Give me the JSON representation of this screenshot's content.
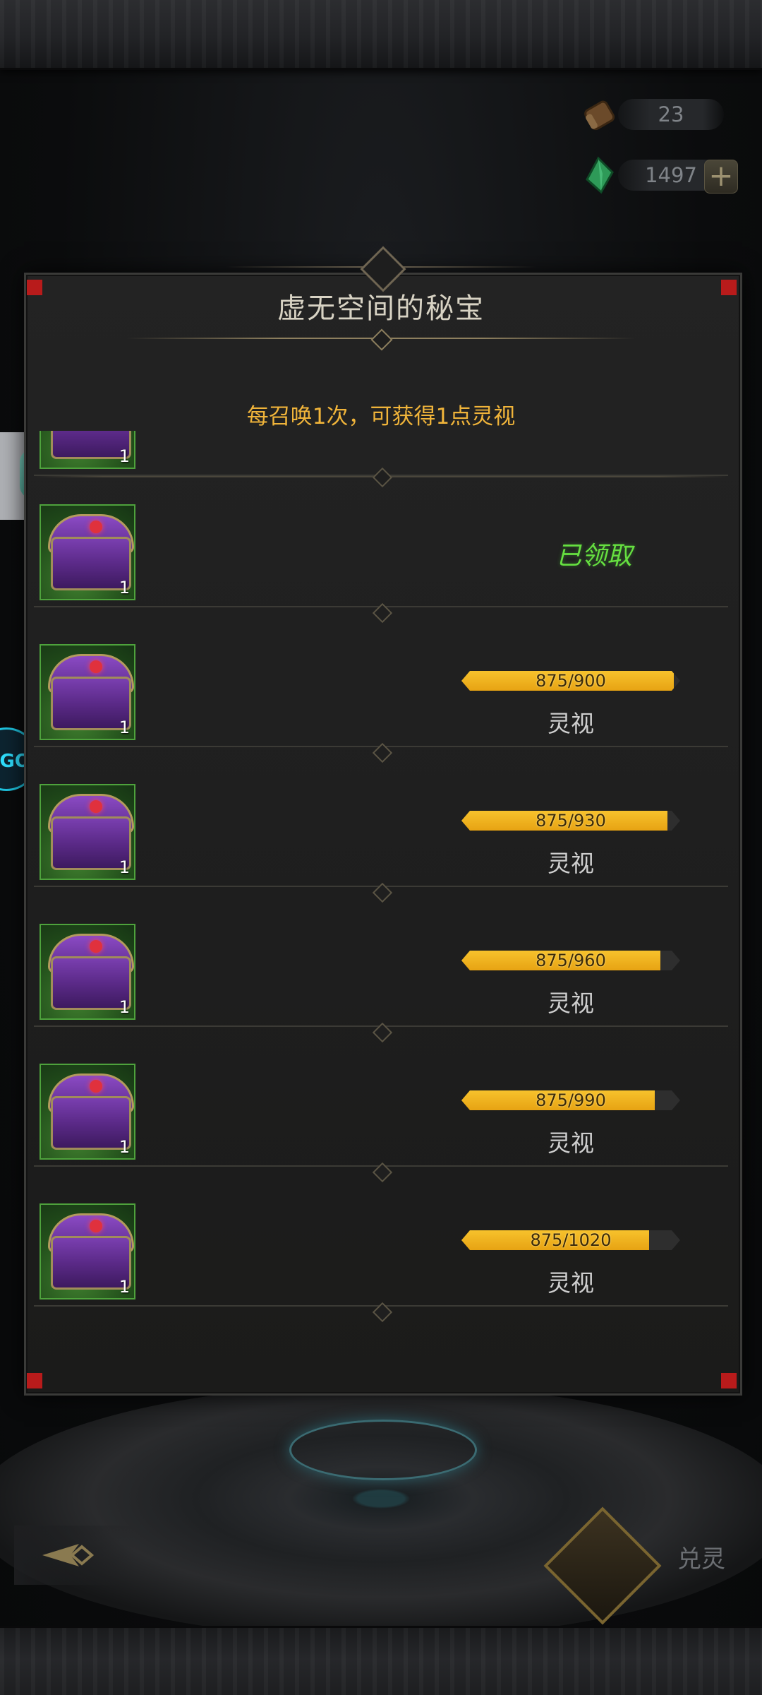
{
  "currencies": {
    "scroll": {
      "icon": "scroll-icon",
      "value": "23"
    },
    "gem": {
      "icon": "green-gem-icon",
      "value": "1497",
      "add_label": "+"
    }
  },
  "panel": {
    "title": "虚无空间的秘宝",
    "subtitle": "每召唤1次，可获得1点灵视"
  },
  "rewards": [
    {
      "count": "1",
      "status": "partial-visible"
    },
    {
      "count": "1",
      "claimed_label": "已领取"
    },
    {
      "count": "1",
      "progress_text": "875/900",
      "progress": 0.972,
      "label": "灵视"
    },
    {
      "count": "1",
      "progress_text": "875/930",
      "progress": 0.941,
      "label": "灵视"
    },
    {
      "count": "1",
      "progress_text": "875/960",
      "progress": 0.911,
      "label": "灵视"
    },
    {
      "count": "1",
      "progress_text": "875/990",
      "progress": 0.884,
      "label": "灵视"
    },
    {
      "count": "1",
      "progress_text": "875/1020",
      "progress": 0.858,
      "label": "灵视"
    }
  ],
  "bottom": {
    "exchange_label": "兑灵",
    "back_icon": "back-arrow-icon"
  },
  "colors": {
    "accent_gold": "#f0b43a",
    "progress_fill": "#f7c22c",
    "claimed_green": "#66e040",
    "item_frame_green": "#4ea23c"
  }
}
